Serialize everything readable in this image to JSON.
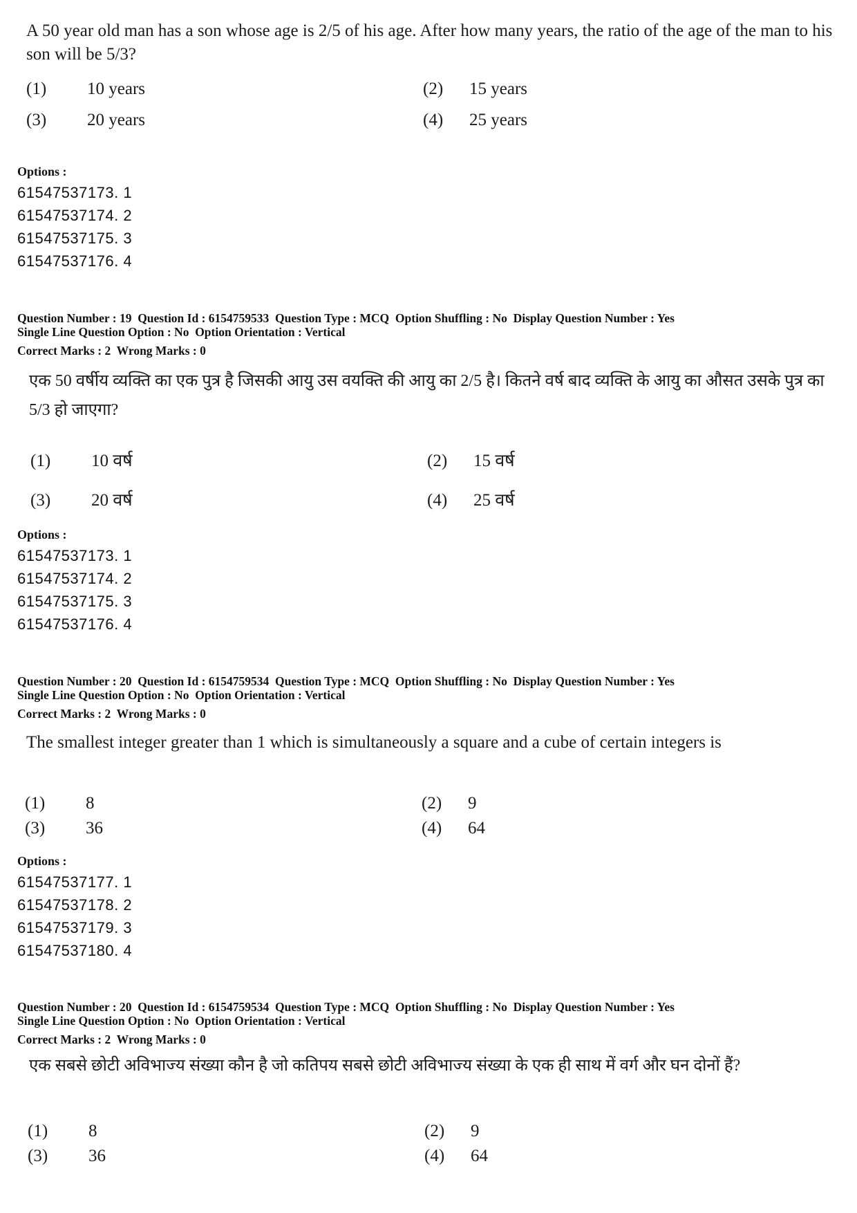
{
  "block1": {
    "question_text": "A 50 year old man has a son whose age is 2/5 of his age. After how many years, the ratio of the age of the man to his son will be 5/3?",
    "choices": [
      {
        "num": "(1)",
        "text": "10 years"
      },
      {
        "num": "(2)",
        "text": "15 years"
      },
      {
        "num": "(3)",
        "text": "20 years"
      },
      {
        "num": "(4)",
        "text": "25 years"
      }
    ],
    "options_label": "Options :",
    "option_ids": [
      "61547537173. 1",
      "61547537174. 2",
      "61547537175. 3",
      "61547537176. 4"
    ]
  },
  "block2": {
    "meta_line1": "Question Number : 19  Question Id : 6154759533  Question Type : MCQ  Option Shuffling : No  Display Question Number : Yes",
    "meta_line2": "Single Line Question Option : No  Option Orientation : Vertical",
    "marks": "Correct Marks : 2  Wrong Marks : 0",
    "question_text": "एक 50 वर्षीय व्यक्ति का एक पुत्र है जिसकी आयु उस वयक्ति की आयु का 2/5 है।  कितने वर्ष बाद व्यक्ति के आयु का औसत उसके पुत्र का 5/3 हो जाएगा?",
    "choices": [
      {
        "num": "(1)",
        "text": "10 वर्ष"
      },
      {
        "num": "(2)",
        "text": "15 वर्ष"
      },
      {
        "num": "(3)",
        "text": "20 वर्ष"
      },
      {
        "num": "(4)",
        "text": "25 वर्ष"
      }
    ],
    "options_label": "Options :",
    "option_ids": [
      "61547537173. 1",
      "61547537174. 2",
      "61547537175. 3",
      "61547537176. 4"
    ]
  },
  "block3": {
    "meta_line1": "Question Number : 20  Question Id : 6154759534  Question Type : MCQ  Option Shuffling : No  Display Question Number : Yes",
    "meta_line2": "Single Line Question Option : No  Option Orientation : Vertical",
    "marks": "Correct Marks : 2  Wrong Marks : 0",
    "question_text": "The smallest integer greater than 1 which is simultaneously a square and a cube of certain integers is",
    "choices": [
      {
        "num": "(1)",
        "text": "8"
      },
      {
        "num": "(2)",
        "text": "9"
      },
      {
        "num": "(3)",
        "text": "36"
      },
      {
        "num": "(4)",
        "text": "64"
      }
    ],
    "options_label": "Options :",
    "option_ids": [
      "61547537177. 1",
      "61547537178. 2",
      "61547537179. 3",
      "61547537180. 4"
    ]
  },
  "block4": {
    "meta_line1": "Question Number : 20  Question Id : 6154759534  Question Type : MCQ  Option Shuffling : No  Display Question Number : Yes",
    "meta_line2": "Single Line Question Option : No  Option Orientation : Vertical",
    "marks": "Correct Marks : 2  Wrong Marks : 0",
    "question_text": "एक सबसे छोटी अविभाज्य संख्या कौन है जो कतिपय सबसे छोटी अविभाज्य संख्या के एक ही साथ में वर्ग और घन दोनों हैं?",
    "choices": [
      {
        "num": "(1)",
        "text": "8"
      },
      {
        "num": "(2)",
        "text": "9"
      },
      {
        "num": "(3)",
        "text": "36"
      },
      {
        "num": "(4)",
        "text": "64"
      }
    ]
  }
}
